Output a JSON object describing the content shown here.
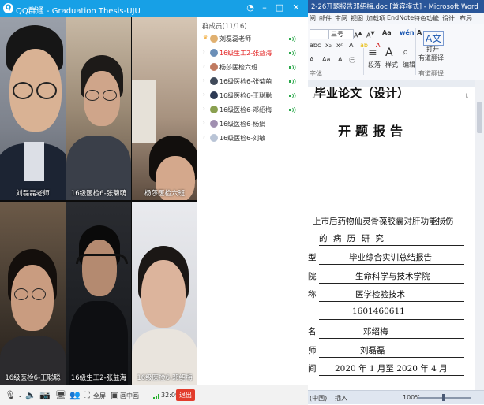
{
  "qq": {
    "title": "QQ群通 - Graduation Thesis-UJU",
    "video_tiles": [
      {
        "label": "刘磊磊老师"
      },
      {
        "label": "16级医检6-张菊萌"
      },
      {
        "label": "杨莎医检六班"
      },
      {
        "label": "16级医检6-王聪聪"
      },
      {
        "label": "16级生工2-张益海"
      },
      {
        "label": "16级医检6-邓绍梅"
      }
    ],
    "member_panel": {
      "header": "群成员(11/16)",
      "members": [
        {
          "name": "刘磊磊老师",
          "highlight": false
        },
        {
          "name": "16级生工2-张益海",
          "highlight": true
        },
        {
          "name": "杨莎医检六班",
          "highlight": false
        },
        {
          "name": "16级医检6-张菊萌",
          "highlight": false
        },
        {
          "name": "16级医检6-王聪聪",
          "highlight": false
        },
        {
          "name": "16级医检6-邓绍梅",
          "highlight": false
        },
        {
          "name": "16级医检6-杨娟",
          "highlight": false
        },
        {
          "name": "16级医检6-刘敏",
          "highlight": false
        }
      ]
    },
    "toolbar": {
      "fullscreen_label": "全屏",
      "pip_label": "画中画",
      "time": "32:09",
      "exit_label": "退出"
    }
  },
  "word": {
    "title": "2-26开题报告邓绍梅.doc [兼容模式] - Microsoft Word",
    "menu": [
      "阅",
      "邮件",
      "审阅",
      "视图",
      "加载项",
      "EndNote",
      "特色功能",
      "设计",
      "布局"
    ],
    "ribbon": {
      "font_size": "三号",
      "paragraph_label": "段落",
      "styles_label": "样式",
      "editing_label": "编辑",
      "open_translate_line1": "打开",
      "open_translate_line2": "有道翻译",
      "translate_group": "有道翻译",
      "font_group": "字体"
    },
    "doc": {
      "header_partial": "毕业论文（设计）",
      "title": "开题报告",
      "row_title_1": "上市后药物仙灵骨葆胶囊对肝功能损伤",
      "row_title_2": "的  病  历  研  究",
      "rows": [
        {
          "left": "型",
          "value": "毕业综合实训总结报告"
        },
        {
          "left": "院",
          "value": "生命科学与技术学院"
        },
        {
          "left": "称",
          "value": "医学检验技术"
        },
        {
          "left": "",
          "value": "1601460611"
        },
        {
          "left": "名",
          "value": "邓绍梅"
        },
        {
          "left": "师",
          "value": "刘磊磊"
        },
        {
          "left": "间",
          "value": "2020 年 1 月至 2020 年 4 月"
        }
      ]
    },
    "status": {
      "mode": "(中国)",
      "insert": "插入",
      "zoom": "100%"
    }
  }
}
